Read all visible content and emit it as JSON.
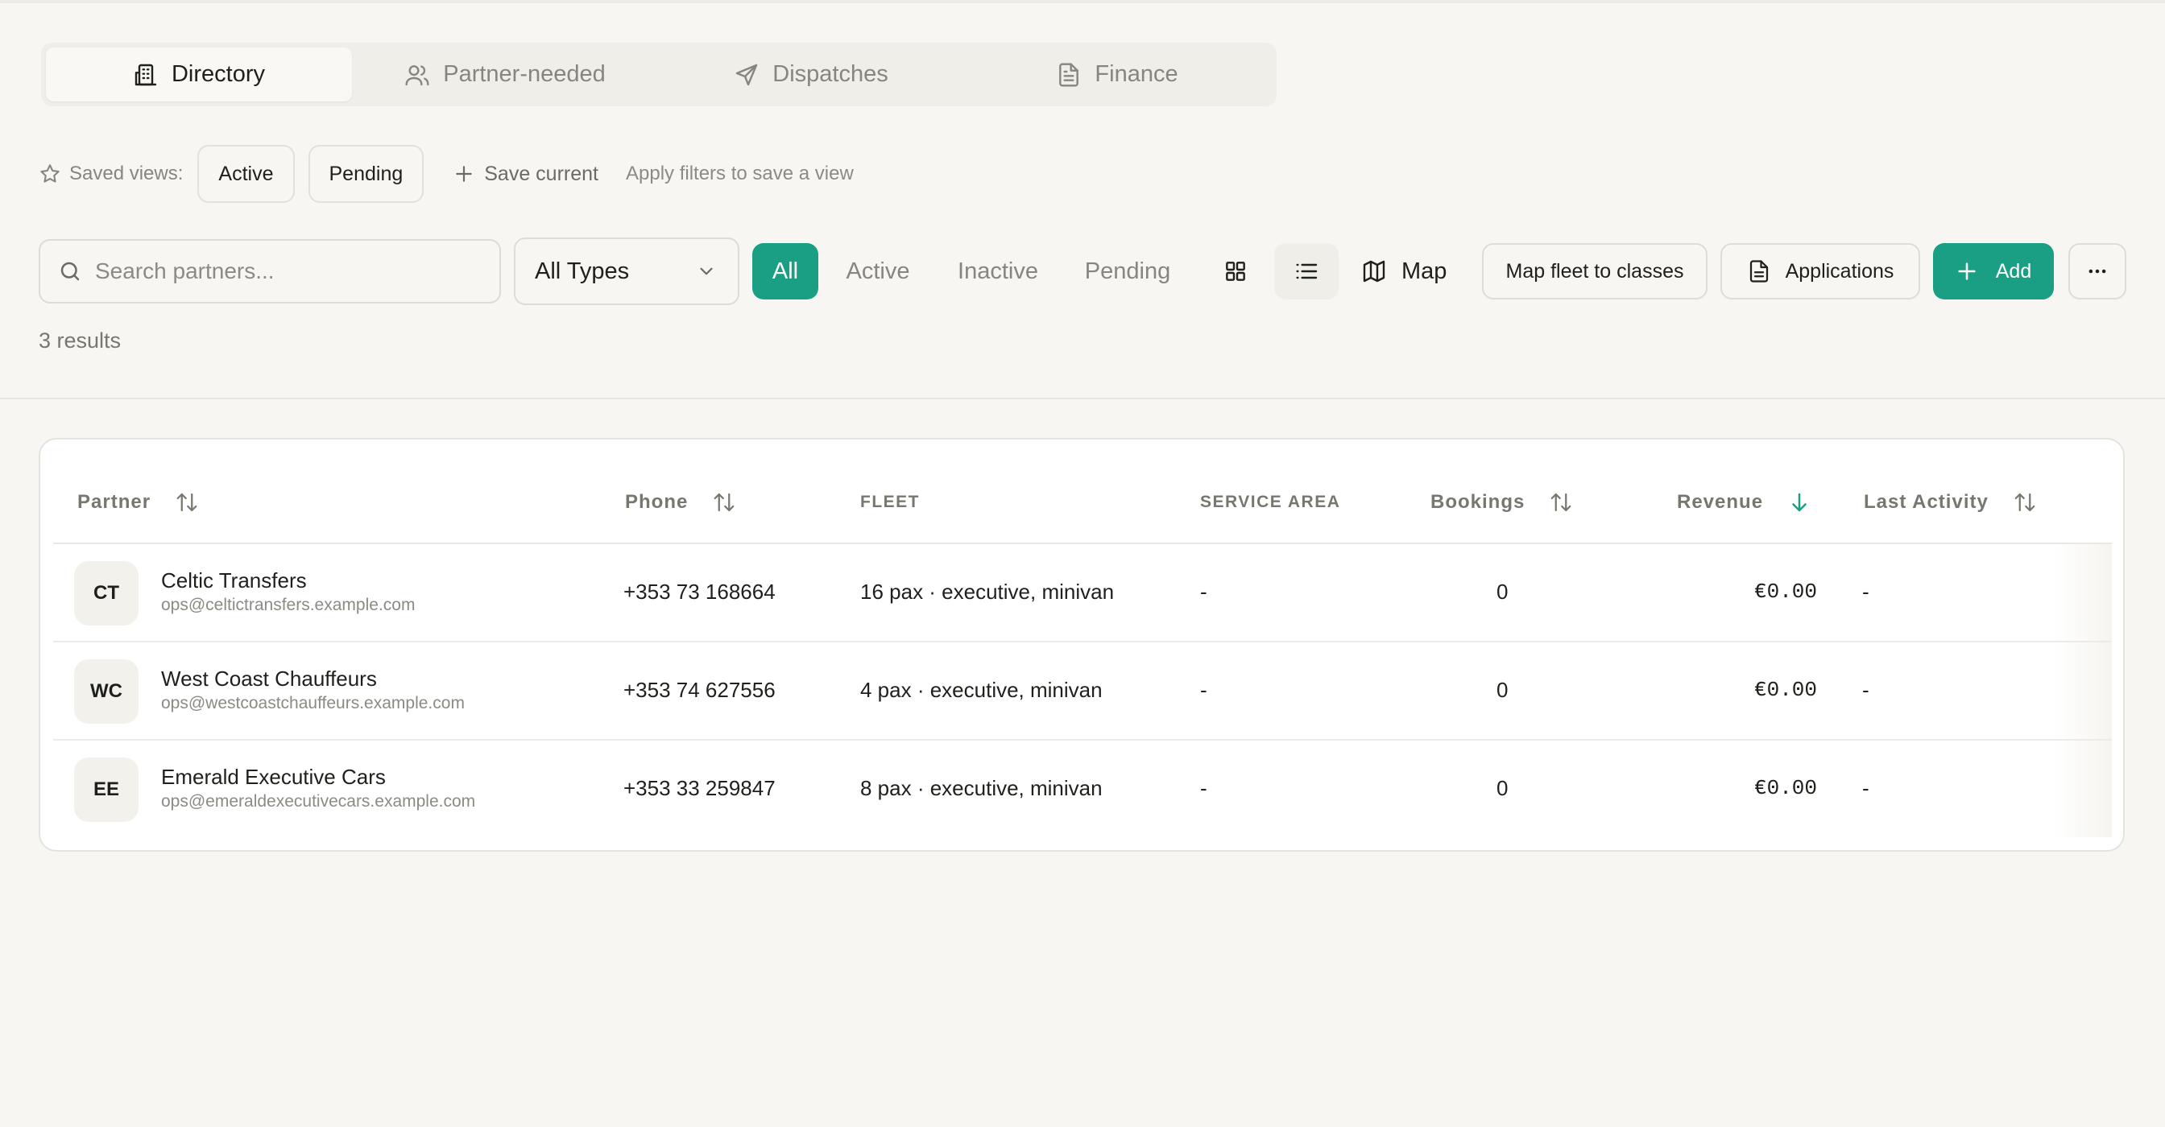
{
  "tabs": [
    {
      "label": "Directory",
      "icon": "building-icon",
      "active": true
    },
    {
      "label": "Partner-needed",
      "icon": "users-icon",
      "active": false
    },
    {
      "label": "Dispatches",
      "icon": "send-icon",
      "active": false
    },
    {
      "label": "Finance",
      "icon": "document-icon",
      "active": false
    }
  ],
  "saved_views": {
    "label": "Saved views:",
    "views": [
      "Active",
      "Pending"
    ],
    "save_current": "Save current",
    "hint": "Apply filters to save a view"
  },
  "toolbar": {
    "search_placeholder": "Search partners...",
    "type_select": "All Types",
    "filters": [
      "All",
      "Active",
      "Inactive",
      "Pending"
    ],
    "active_filter": "All",
    "map_label": "Map",
    "map_fleet_label": "Map fleet to classes",
    "applications_label": "Applications",
    "add_label": "Add"
  },
  "results": "3 results",
  "table": {
    "columns": {
      "partner": "Partner",
      "phone": "Phone",
      "fleet": "FLEET",
      "service_area": "SERVICE AREA",
      "bookings": "Bookings",
      "revenue": "Revenue",
      "last_activity": "Last Activity"
    },
    "rows": [
      {
        "initials": "CT",
        "name": "Celtic Transfers",
        "email": "ops@celtictransfers.example.com",
        "phone": "+353 73 168664",
        "fleet": "16 pax · executive, minivan",
        "service_area": "-",
        "bookings": "0",
        "revenue": "€0.00",
        "last_activity": "-"
      },
      {
        "initials": "WC",
        "name": "West Coast Chauffeurs",
        "email": "ops@westcoastchauffeurs.example.com",
        "phone": "+353 74 627556",
        "fleet": "4 pax · executive, minivan",
        "service_area": "-",
        "bookings": "0",
        "revenue": "€0.00",
        "last_activity": "-"
      },
      {
        "initials": "EE",
        "name": "Emerald Executive Cars",
        "email": "ops@emeraldexecutivecars.example.com",
        "phone": "+353 33 259847",
        "fleet": "8 pax · executive, minivan",
        "service_area": "-",
        "bookings": "0",
        "revenue": "€0.00",
        "last_activity": "-"
      }
    ]
  },
  "colors": {
    "accent": "#1a9e84",
    "background": "#f7f6f2",
    "muted": "#86867f"
  }
}
